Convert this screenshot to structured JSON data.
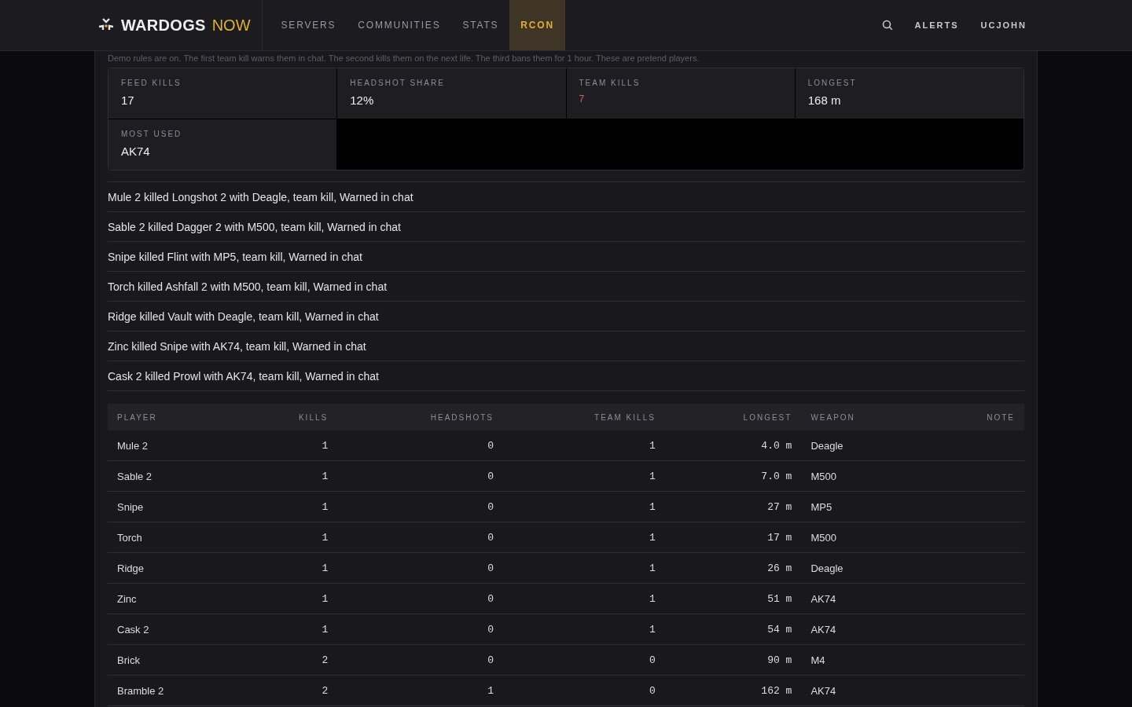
{
  "nav": {
    "brand_main": "WARDOGS",
    "brand_accent": "NOW",
    "links": [
      {
        "label": "SERVERS",
        "selected": false
      },
      {
        "label": "COMMUNITIES",
        "selected": false
      },
      {
        "label": "STATS",
        "selected": false
      },
      {
        "label": "RCON",
        "selected": true
      }
    ],
    "right_links": [
      "ALERTS",
      "UCJOHN"
    ]
  },
  "notice": "Demo rules are on. The first team kill warns them in chat. The second kills them on the next life. The third bans them for 1 hour. These are pretend players.",
  "stats": [
    {
      "label": "FEED KILLS",
      "value": "17",
      "alert": false
    },
    {
      "label": "HEADSHOT SHARE",
      "value": "12%",
      "alert": false
    },
    {
      "label": "TEAM KILLS",
      "value": "7",
      "alert": true
    },
    {
      "label": "LONGEST",
      "value": "168 m",
      "alert": false
    },
    {
      "label": "MOST USED",
      "value": "AK74",
      "alert": false
    }
  ],
  "feed": [
    "Mule 2 killed Longshot 2 with Deagle, team kill, Warned in chat",
    "Sable 2 killed Dagger 2 with M500, team kill, Warned in chat",
    "Snipe killed Flint with MP5, team kill, Warned in chat",
    "Torch killed Ashfall 2 with M500, team kill, Warned in chat",
    "Ridge killed Vault with Deagle, team kill, Warned in chat",
    "Zinc killed Snipe with AK74, team kill, Warned in chat",
    "Cask 2 killed Prowl with AK74, team kill, Warned in chat"
  ],
  "table": {
    "columns": [
      "PLAYER",
      "KILLS",
      "HEADSHOTS",
      "TEAM KILLS",
      "LONGEST",
      "WEAPON",
      "NOTE"
    ],
    "rows": [
      [
        "Mule 2",
        "1",
        "0",
        "1",
        "4.0 m",
        "Deagle"
      ],
      [
        "Sable 2",
        "1",
        "0",
        "1",
        "7.0 m",
        "M500"
      ],
      [
        "Snipe",
        "1",
        "0",
        "1",
        "27 m",
        "MP5"
      ],
      [
        "Torch",
        "1",
        "0",
        "1",
        "17 m",
        "M500"
      ],
      [
        "Ridge",
        "1",
        "0",
        "1",
        "26 m",
        "Deagle"
      ],
      [
        "Zinc",
        "1",
        "0",
        "1",
        "51 m",
        "AK74"
      ],
      [
        "Cask 2",
        "1",
        "0",
        "1",
        "54 m",
        "AK74"
      ],
      [
        "Brick",
        "2",
        "0",
        "0",
        "90 m",
        "M4"
      ],
      [
        "Bramble 2",
        "2",
        "1",
        "0",
        "162 m",
        "AK74"
      ]
    ]
  }
}
